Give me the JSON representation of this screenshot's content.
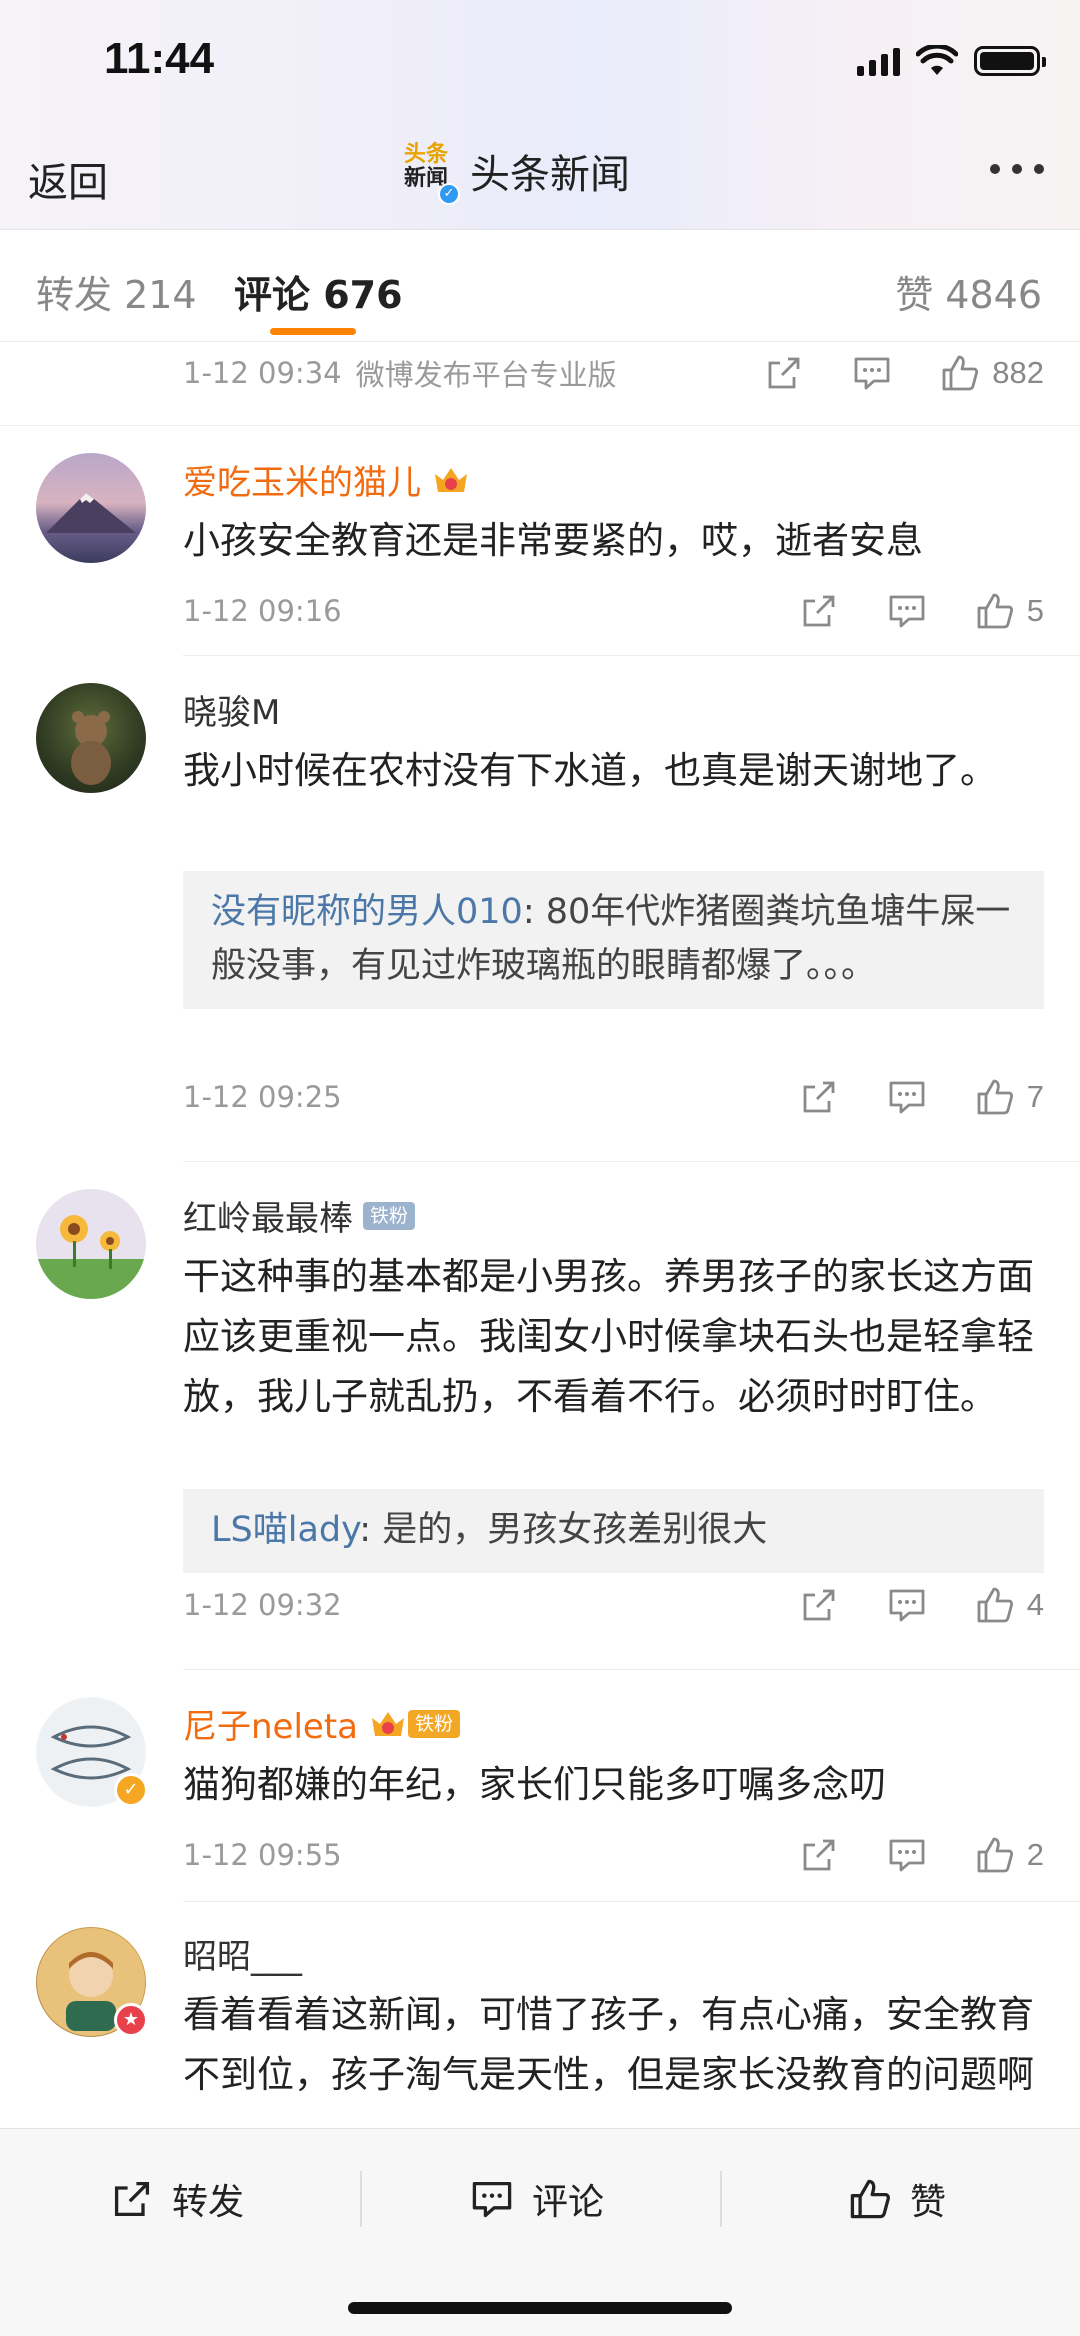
{
  "status_bar": {
    "time": "11:44"
  },
  "nav": {
    "back_label": "返回",
    "logo_line1": "头条",
    "logo_line2": "新闻",
    "title": "头条新闻"
  },
  "tabs": {
    "forward": "转发 214",
    "comment": "评论 676",
    "like": "赞 4846"
  },
  "post_meta": {
    "time": "1-12 09:34",
    "source": "微博发布平台专业版",
    "likes": "882"
  },
  "comments": [
    {
      "name": "爱吃玉米的猫儿",
      "text": "小孩安全教育还是非常要紧的，哎，逝者安息",
      "time": "1-12 09:16",
      "likes": "5"
    },
    {
      "name": "晓骏M",
      "text": "我小时候在农村没有下水道，也真是谢天谢地了。",
      "reply_name": "没有昵称的男人010",
      "reply_text": ": 80年代炸猪圈粪坑鱼塘牛屎一般没事，有见过炸玻璃瓶的眼睛都爆了。。。",
      "time": "1-12 09:25",
      "likes": "7"
    },
    {
      "name": "红岭最最棒",
      "badge": "铁粉",
      "text": "干这种事的基本都是小男孩。养男孩子的家长这方面应该更重视一点。我闺女小时候拿块石头也是轻拿轻放，我儿子就乱扔，不看着不行。必须时时盯住。",
      "reply_name": "LS喵lady",
      "reply_text": ": 是的，男孩女孩差别很大",
      "time": "1-12 09:32",
      "likes": "4"
    },
    {
      "name": "尼子neleta",
      "badge": "铁粉",
      "text": "猫狗都嫌的年纪，家长们只能多叮嘱多念叨",
      "time": "1-12 09:55",
      "likes": "2"
    },
    {
      "name": "昭昭___",
      "text": "看着看着这新闻，可惜了孩子，有点心痛，安全教育不到位，孩子淘气是天性，但是家长没教育的问题啊"
    }
  ],
  "bottom_bar": {
    "forward": "转发",
    "comment": "评论",
    "like": "赞"
  },
  "colors": {
    "accent": "#ff8200",
    "vip_name": "#f26b0f",
    "reply_name": "#4b78a8"
  }
}
